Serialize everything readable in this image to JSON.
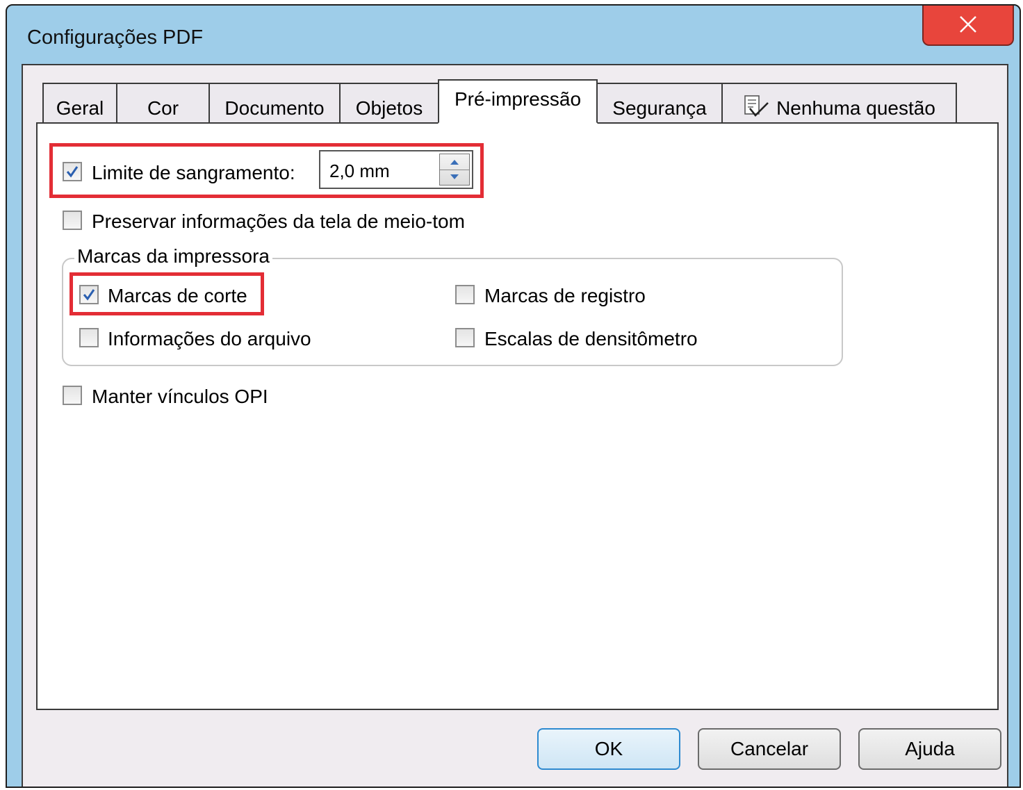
{
  "window": {
    "title": "Configurações PDF"
  },
  "tabs": [
    {
      "label": "Geral"
    },
    {
      "label": "Cor"
    },
    {
      "label": "Documento"
    },
    {
      "label": "Objetos"
    },
    {
      "label": "Pré-impressão",
      "active": true
    },
    {
      "label": "Segurança"
    },
    {
      "label": "Nenhuma questão",
      "icon": "checklist-icon"
    }
  ],
  "preprint": {
    "bleed": {
      "label": "Limite de sangramento:",
      "checked": true,
      "value": "2,0 mm"
    },
    "halftone": {
      "label": "Preservar informações da tela de meio-tom",
      "checked": false
    },
    "printer_marks": {
      "title": "Marcas da impressora",
      "crop_marks": {
        "label": "Marcas de corte",
        "checked": true
      },
      "registration_marks": {
        "label": "Marcas de registro",
        "checked": false
      },
      "file_info": {
        "label": "Informações do arquivo",
        "checked": false
      },
      "densitometer": {
        "label": "Escalas de densitômetro",
        "checked": false
      }
    },
    "opi": {
      "label": "Manter vínculos OPI",
      "checked": false
    }
  },
  "buttons": {
    "ok": "OK",
    "cancel": "Cancelar",
    "help": "Ajuda"
  },
  "colors": {
    "title_bar": "#9ecde9",
    "close_button": "#e8453c",
    "highlight": "#e32d35",
    "check": "#2a5fb0"
  }
}
